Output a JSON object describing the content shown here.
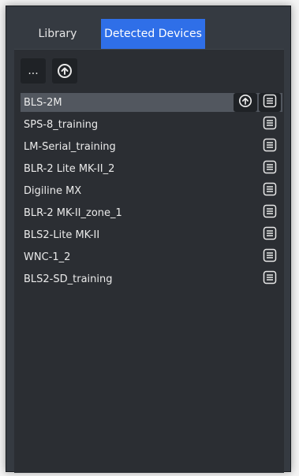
{
  "tabs": [
    {
      "label": "Library"
    },
    {
      "label": "Detected Devices"
    }
  ],
  "toolbar": {
    "more_label": "...",
    "upload_icon": "upload-circle-icon"
  },
  "devices": [
    {
      "name": "BLS-2M"
    },
    {
      "name": "SPS-8_training"
    },
    {
      "name": "LM-Serial_training"
    },
    {
      "name": "BLR-2 Lite MK-II_2"
    },
    {
      "name": "Digiline MX"
    },
    {
      "name": "BLR-2 MK-II_zone_1"
    },
    {
      "name": "BLS2-Lite MK-II"
    },
    {
      "name": "WNC-1_2"
    },
    {
      "name": "BLS2-SD_training"
    }
  ],
  "colors": {
    "accent": "#2f6fe8",
    "background": "#2b2e33",
    "selected_row": "#52575f"
  }
}
